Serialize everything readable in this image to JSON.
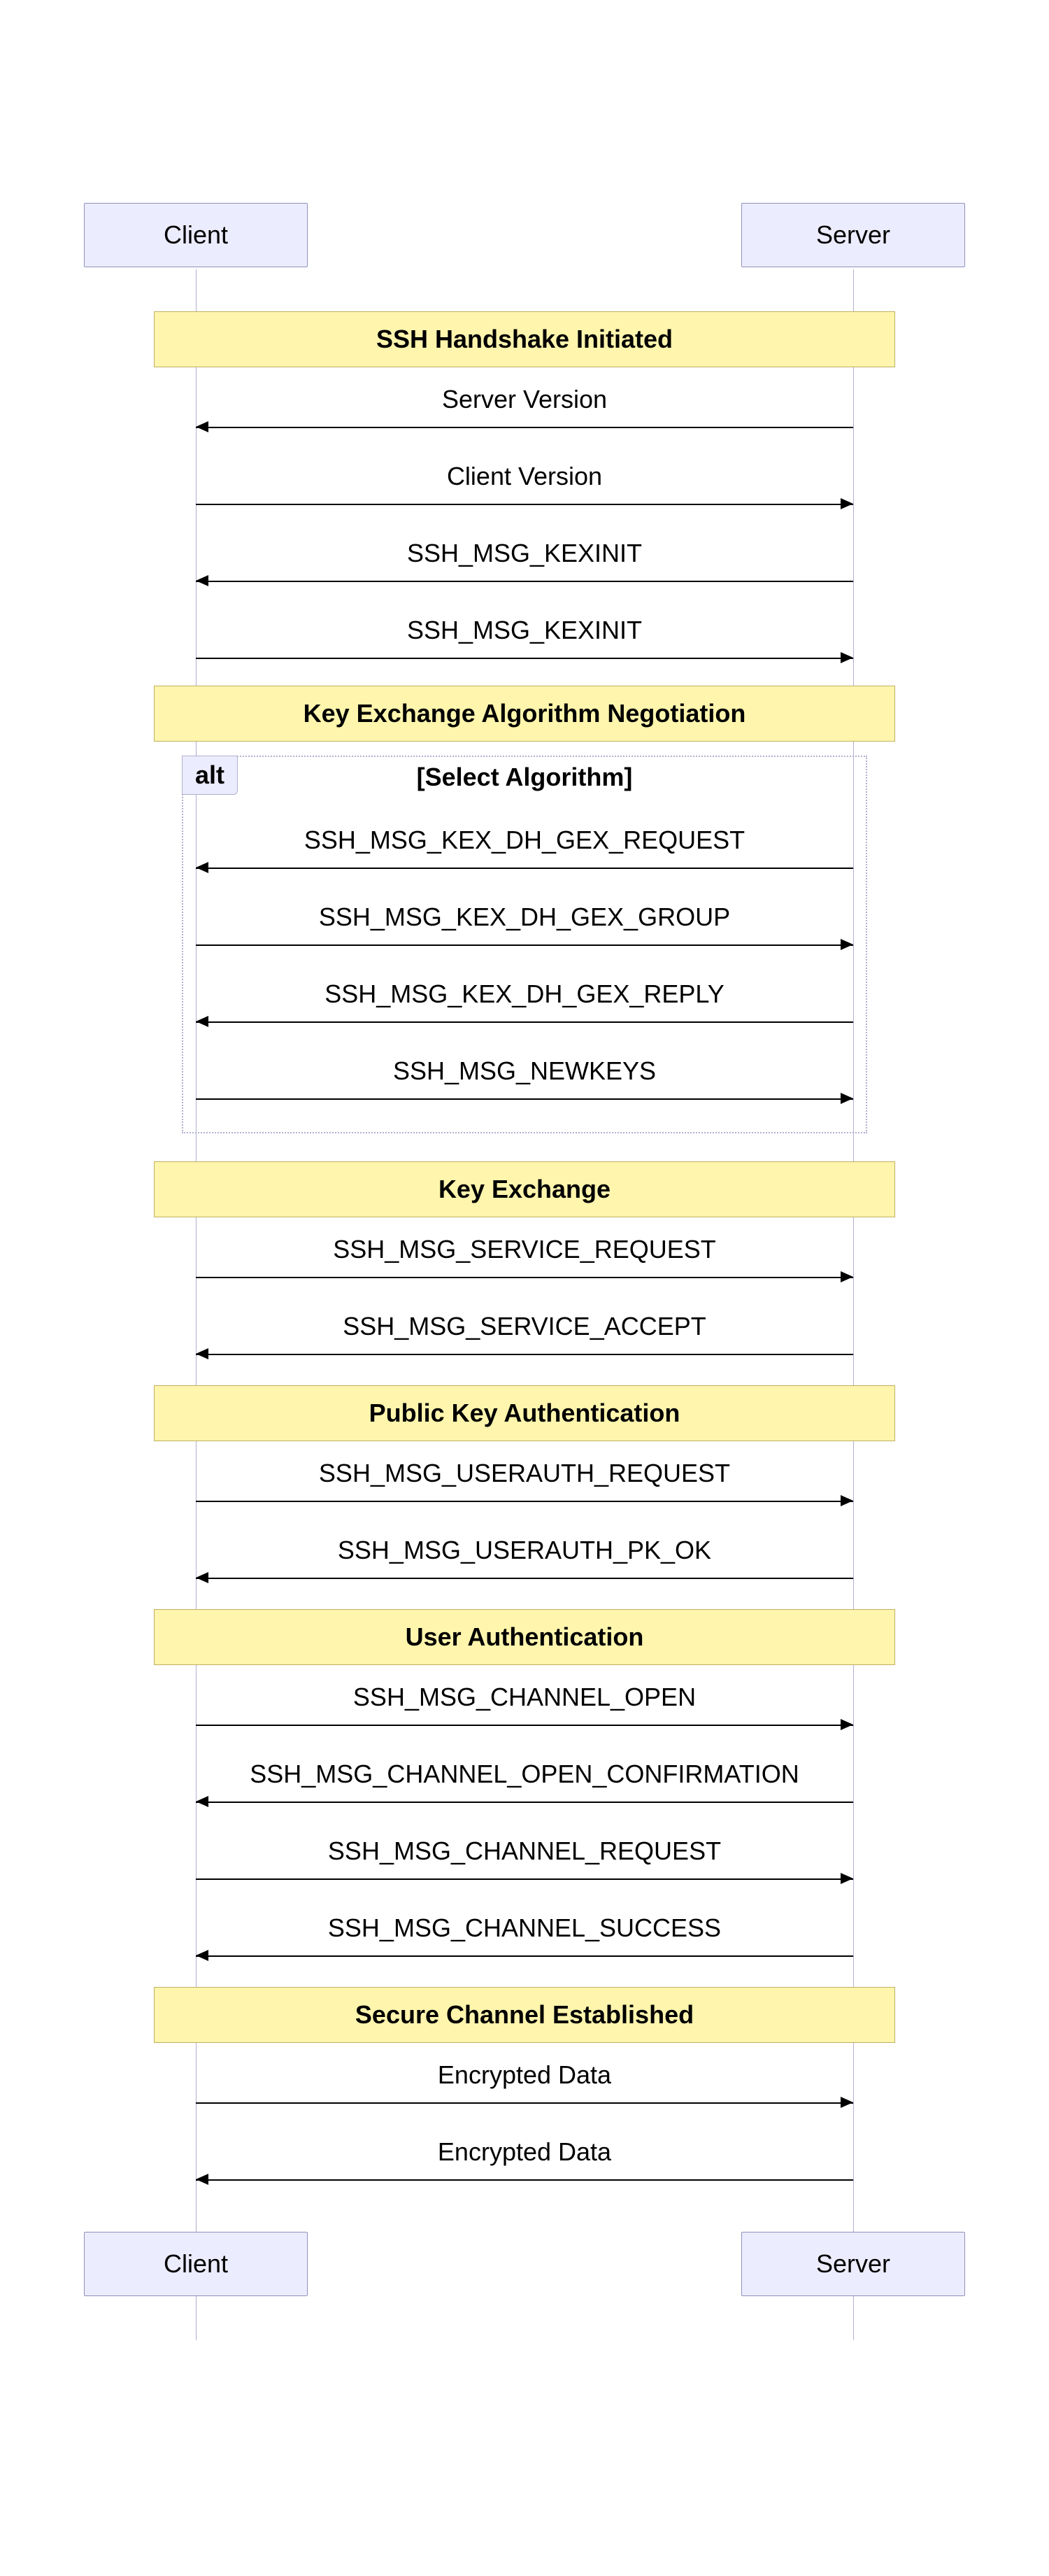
{
  "participants": {
    "client": "Client",
    "server": "Server"
  },
  "notes": {
    "n1": "SSH Handshake Initiated",
    "n2": "Key Exchange Algorithm Negotiation",
    "n3": "Key Exchange",
    "n4": "Public Key Authentication",
    "n5": "User Authentication",
    "n6": "Secure Channel Established"
  },
  "alt": {
    "tag": "alt",
    "title": "[Select Algorithm]"
  },
  "messages": {
    "m1": "Server Version",
    "m2": "Client Version",
    "m3": "SSH_MSG_KEXINIT",
    "m4": "SSH_MSG_KEXINIT",
    "m5": "SSH_MSG_KEX_DH_GEX_REQUEST",
    "m6": "SSH_MSG_KEX_DH_GEX_GROUP",
    "m7": "SSH_MSG_KEX_DH_GEX_REPLY",
    "m8": "SSH_MSG_NEWKEYS",
    "m9": "SSH_MSG_SERVICE_REQUEST",
    "m10": "SSH_MSG_SERVICE_ACCEPT",
    "m11": "SSH_MSG_USERAUTH_REQUEST",
    "m12": "SSH_MSG_USERAUTH_PK_OK",
    "m13": "SSH_MSG_CHANNEL_OPEN",
    "m14": "SSH_MSG_CHANNEL_OPEN_CONFIRMATION",
    "m15": "SSH_MSG_CHANNEL_REQUEST",
    "m16": "SSH_MSG_CHANNEL_SUCCESS",
    "m17": "Encrypted Data",
    "m18": "Encrypted Data"
  }
}
